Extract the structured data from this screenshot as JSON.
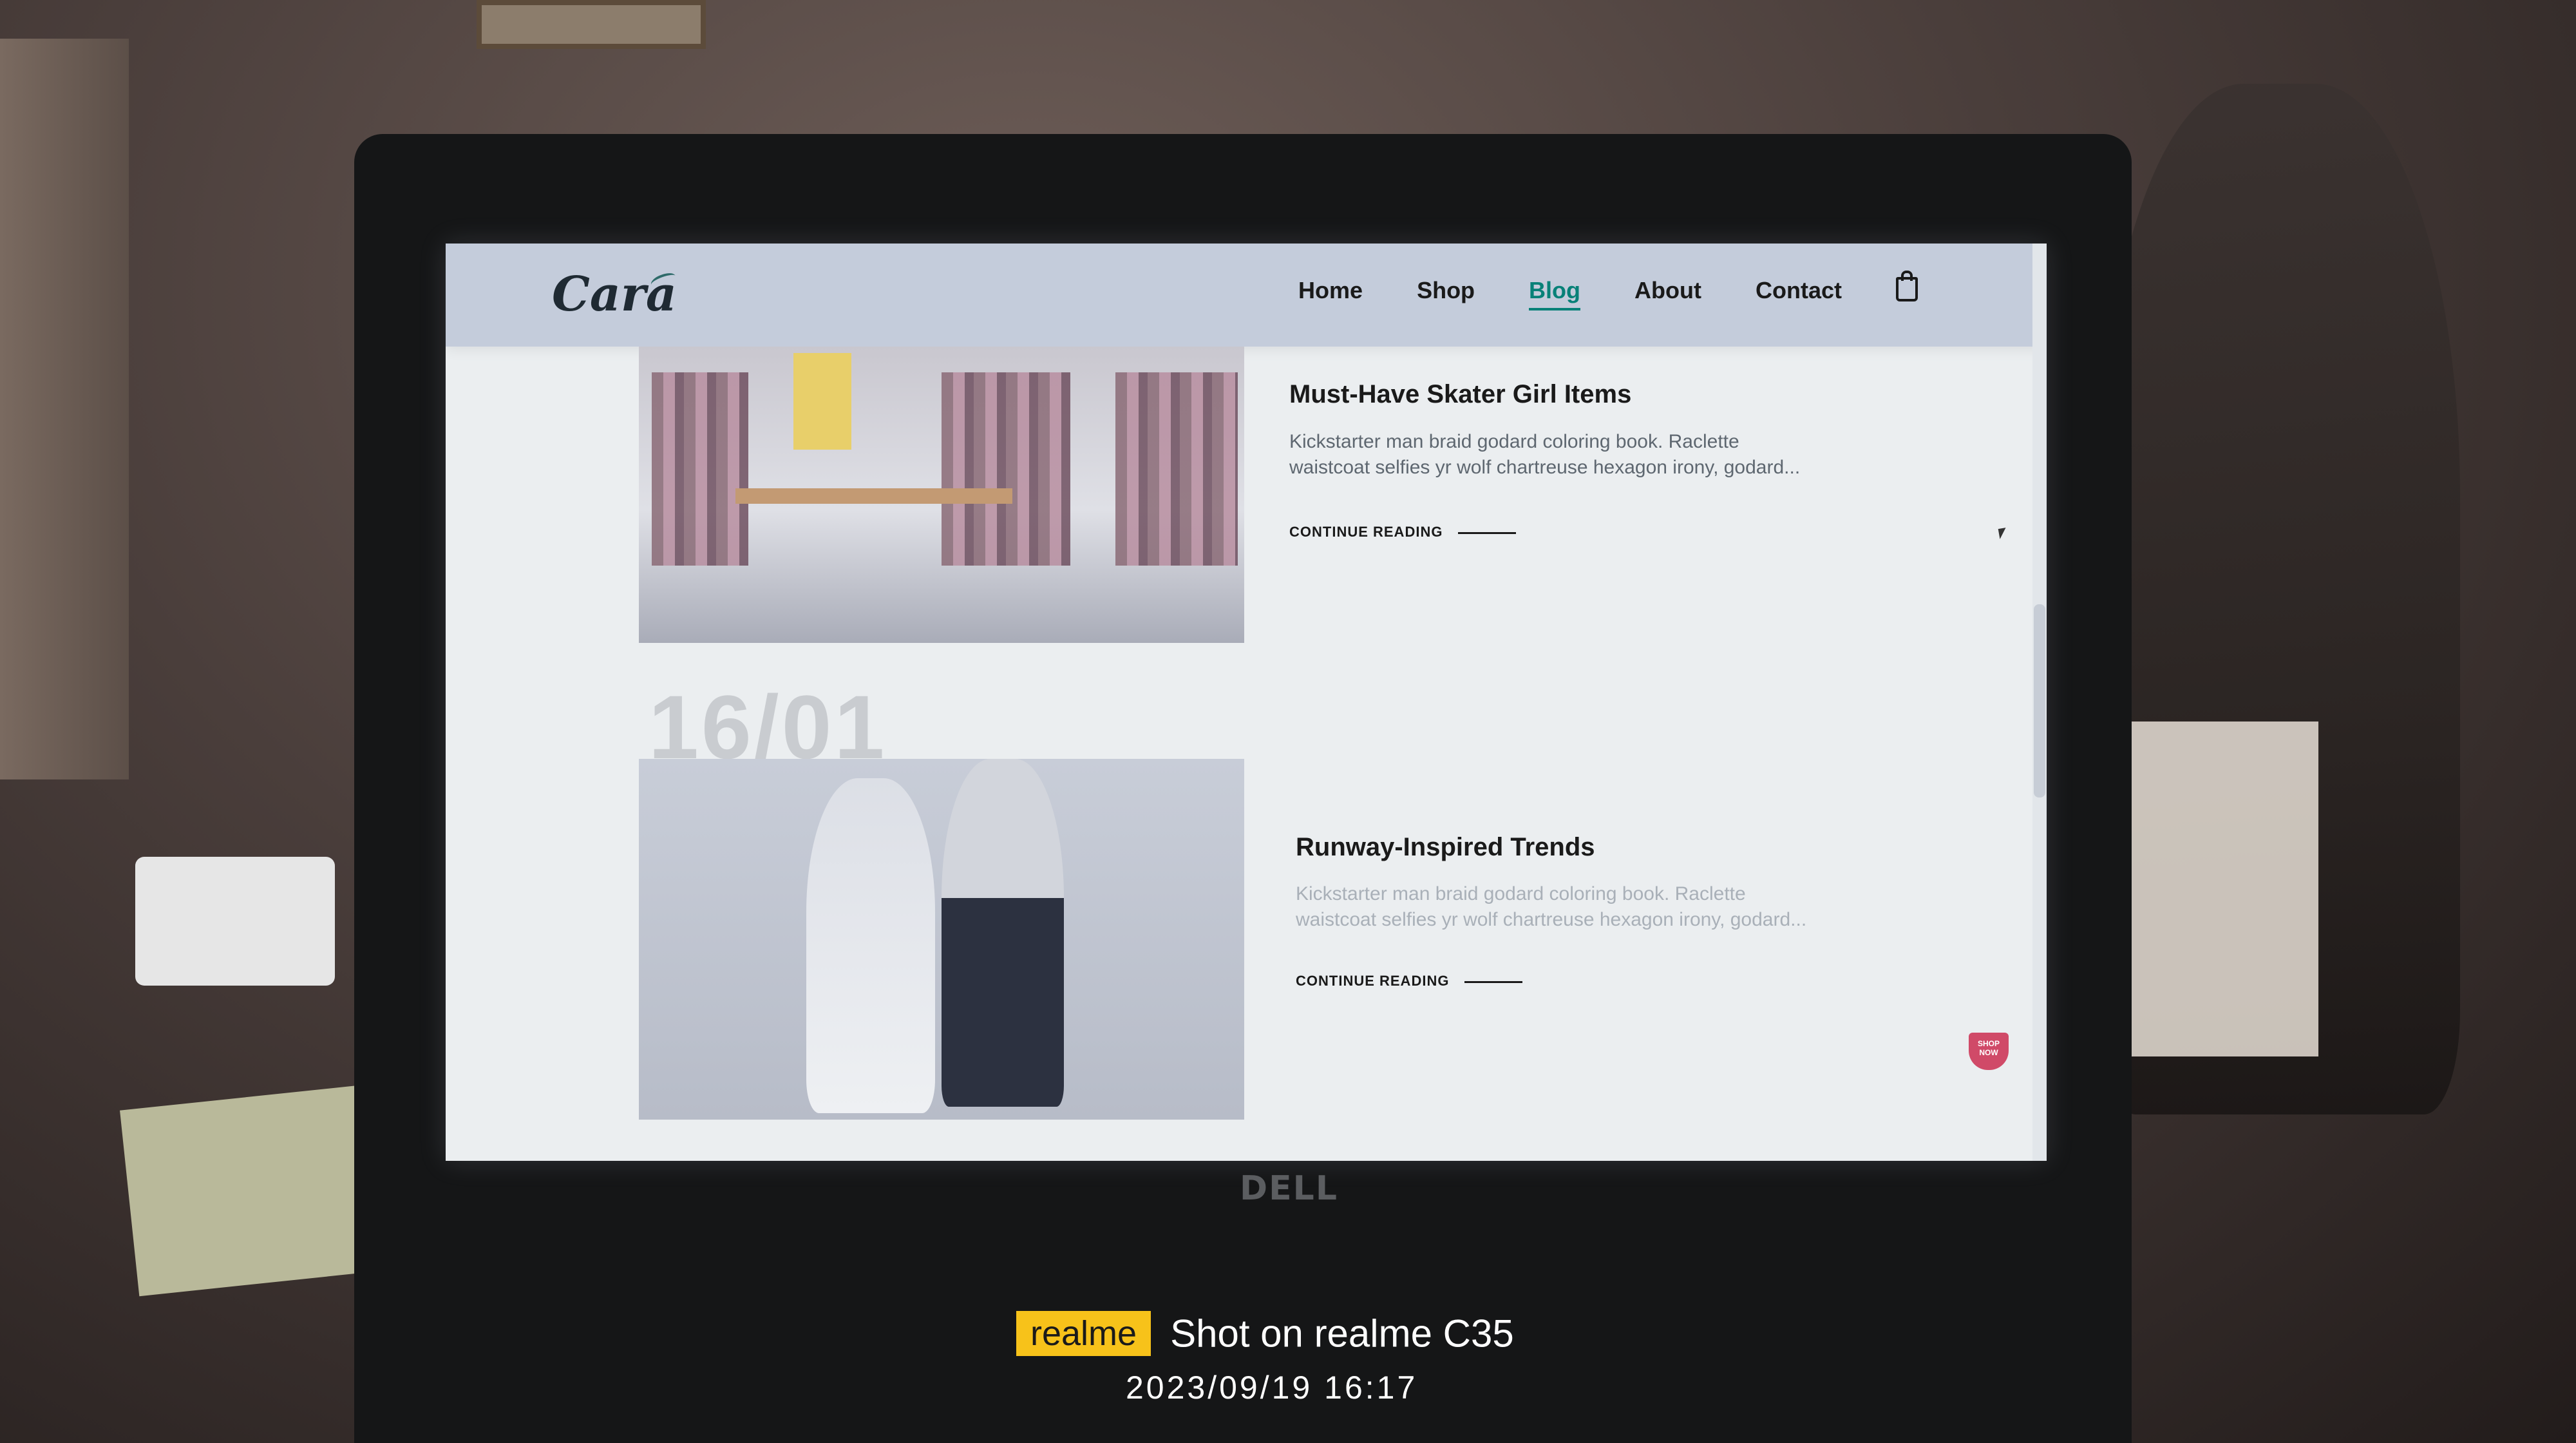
{
  "site": {
    "logo": "Cara",
    "nav": [
      "Home",
      "Shop",
      "Blog",
      "About",
      "Contact"
    ],
    "active_nav": "Blog"
  },
  "posts": [
    {
      "title": "Must-Have Skater Girl Items",
      "excerpt": "Kickstarter man braid godard coloring book. Raclette waistcoat selfies yr wolf chartreuse hexagon irony, godard...",
      "read_more": "CONTINUE READING"
    },
    {
      "date": "16/01",
      "title": "Runway-Inspired Trends",
      "excerpt": "Kickstarter man braid godard coloring book. Raclette waistcoat selfies yr wolf chartreuse hexagon irony, godard...",
      "read_more": "CONTINUE READING"
    }
  ],
  "badge": {
    "text": "SHOP NOW"
  },
  "device": {
    "brand": "DELL"
  },
  "photo_watermark": {
    "tag": "realme",
    "text": "Shot on realme C35",
    "datetime": "2023/09/19  16:17"
  },
  "icons": [
    "cart-icon",
    "cursor-icon",
    "badge-icon"
  ]
}
